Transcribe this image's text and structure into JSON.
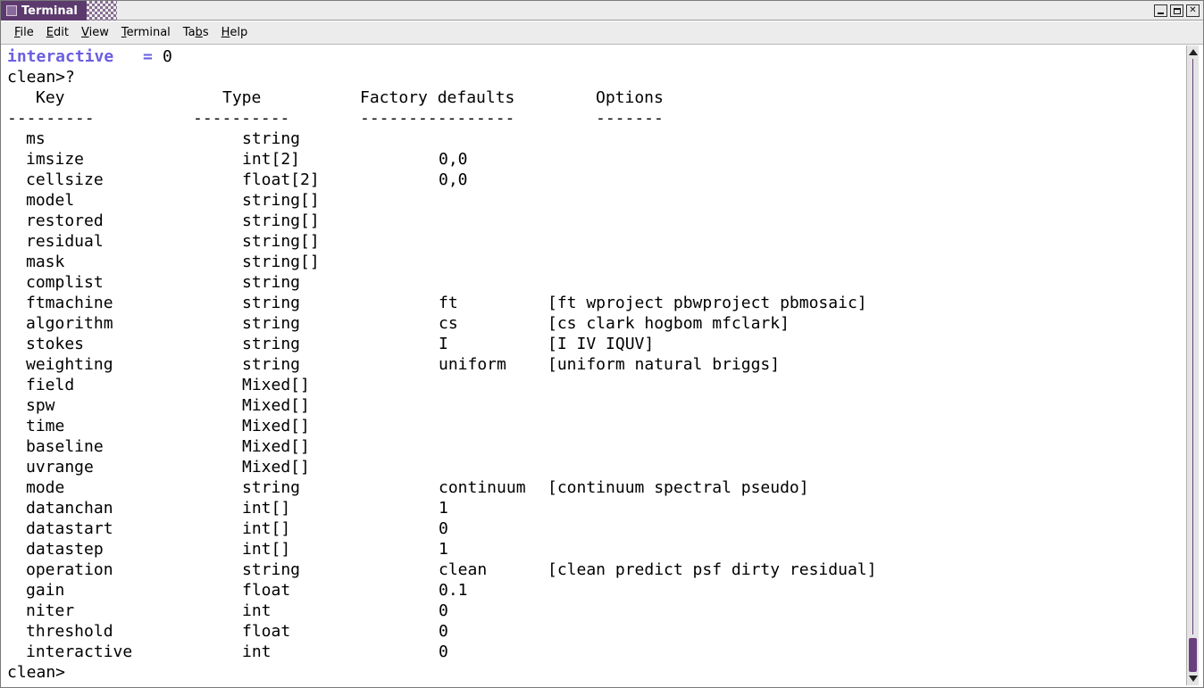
{
  "window": {
    "title": "Terminal"
  },
  "menu": [
    {
      "pre": "",
      "mn": "F",
      "post": "ile"
    },
    {
      "pre": "",
      "mn": "E",
      "post": "dit"
    },
    {
      "pre": "",
      "mn": "V",
      "post": "iew"
    },
    {
      "pre": "",
      "mn": "T",
      "post": "erminal"
    },
    {
      "pre": "Ta",
      "mn": "b",
      "post": "s"
    },
    {
      "pre": "",
      "mn": "H",
      "post": "elp"
    }
  ],
  "terminal": {
    "first_key": "interactive",
    "first_eq": "=",
    "first_val": "0",
    "prompt_query": "clean>?",
    "headers": {
      "key": "Key",
      "type": "Type",
      "defaults": "Factory defaults",
      "options": "Options"
    },
    "dashes": {
      "key": "---------",
      "type": "----------",
      "defaults": "----------------",
      "options": "-------"
    },
    "rows": [
      {
        "key": "ms",
        "type": "string",
        "default": "",
        "options": ""
      },
      {
        "key": "imsize",
        "type": "int[2]",
        "default": "0,0",
        "options": ""
      },
      {
        "key": "cellsize",
        "type": "float[2]",
        "default": "0,0",
        "options": ""
      },
      {
        "key": "model",
        "type": "string[]",
        "default": "",
        "options": ""
      },
      {
        "key": "restored",
        "type": "string[]",
        "default": "",
        "options": ""
      },
      {
        "key": "residual",
        "type": "string[]",
        "default": "",
        "options": ""
      },
      {
        "key": "mask",
        "type": "string[]",
        "default": "",
        "options": ""
      },
      {
        "key": "complist",
        "type": "string",
        "default": "",
        "options": ""
      },
      {
        "key": "ftmachine",
        "type": "string",
        "default": "ft",
        "options": "[ft wproject pbwproject pbmosaic]"
      },
      {
        "key": "algorithm",
        "type": "string",
        "default": "cs",
        "options": "[cs clark hogbom mfclark]"
      },
      {
        "key": "stokes",
        "type": "string",
        "default": "I",
        "options": "[I IV IQUV]"
      },
      {
        "key": "weighting",
        "type": "string",
        "default": "uniform",
        "options": "[uniform natural briggs]"
      },
      {
        "key": "field",
        "type": "Mixed[]",
        "default": "",
        "options": ""
      },
      {
        "key": "spw",
        "type": "Mixed[]",
        "default": "",
        "options": ""
      },
      {
        "key": "time",
        "type": "Mixed[]",
        "default": "",
        "options": ""
      },
      {
        "key": "baseline",
        "type": "Mixed[]",
        "default": "",
        "options": ""
      },
      {
        "key": "uvrange",
        "type": "Mixed[]",
        "default": "",
        "options": ""
      },
      {
        "key": "mode",
        "type": "string",
        "default": "continuum",
        "options": "[continuum spectral pseudo]"
      },
      {
        "key": "datanchan",
        "type": "int[]",
        "default": "1",
        "options": ""
      },
      {
        "key": "datastart",
        "type": "int[]",
        "default": "0",
        "options": ""
      },
      {
        "key": "datastep",
        "type": "int[]",
        "default": "1",
        "options": ""
      },
      {
        "key": "operation",
        "type": "string",
        "default": "clean",
        "options": "[clean predict psf dirty residual]"
      },
      {
        "key": "gain",
        "type": "float",
        "default": "0.1",
        "options": ""
      },
      {
        "key": "niter",
        "type": "int",
        "default": "0",
        "options": ""
      },
      {
        "key": "threshold",
        "type": "float",
        "default": "0",
        "options": ""
      },
      {
        "key": "interactive",
        "type": "int",
        "default": "0",
        "options": ""
      }
    ],
    "final_prompt": "clean>"
  },
  "colors": {
    "highlight": "#6b5fe0",
    "title_bar": "#5c3a6e",
    "scroll_thumb": "#6a3f7e"
  },
  "icons": {
    "window": "terminal-window-icon",
    "minimize": "minimize-icon",
    "maximize": "maximize-icon",
    "close": "close-icon"
  }
}
